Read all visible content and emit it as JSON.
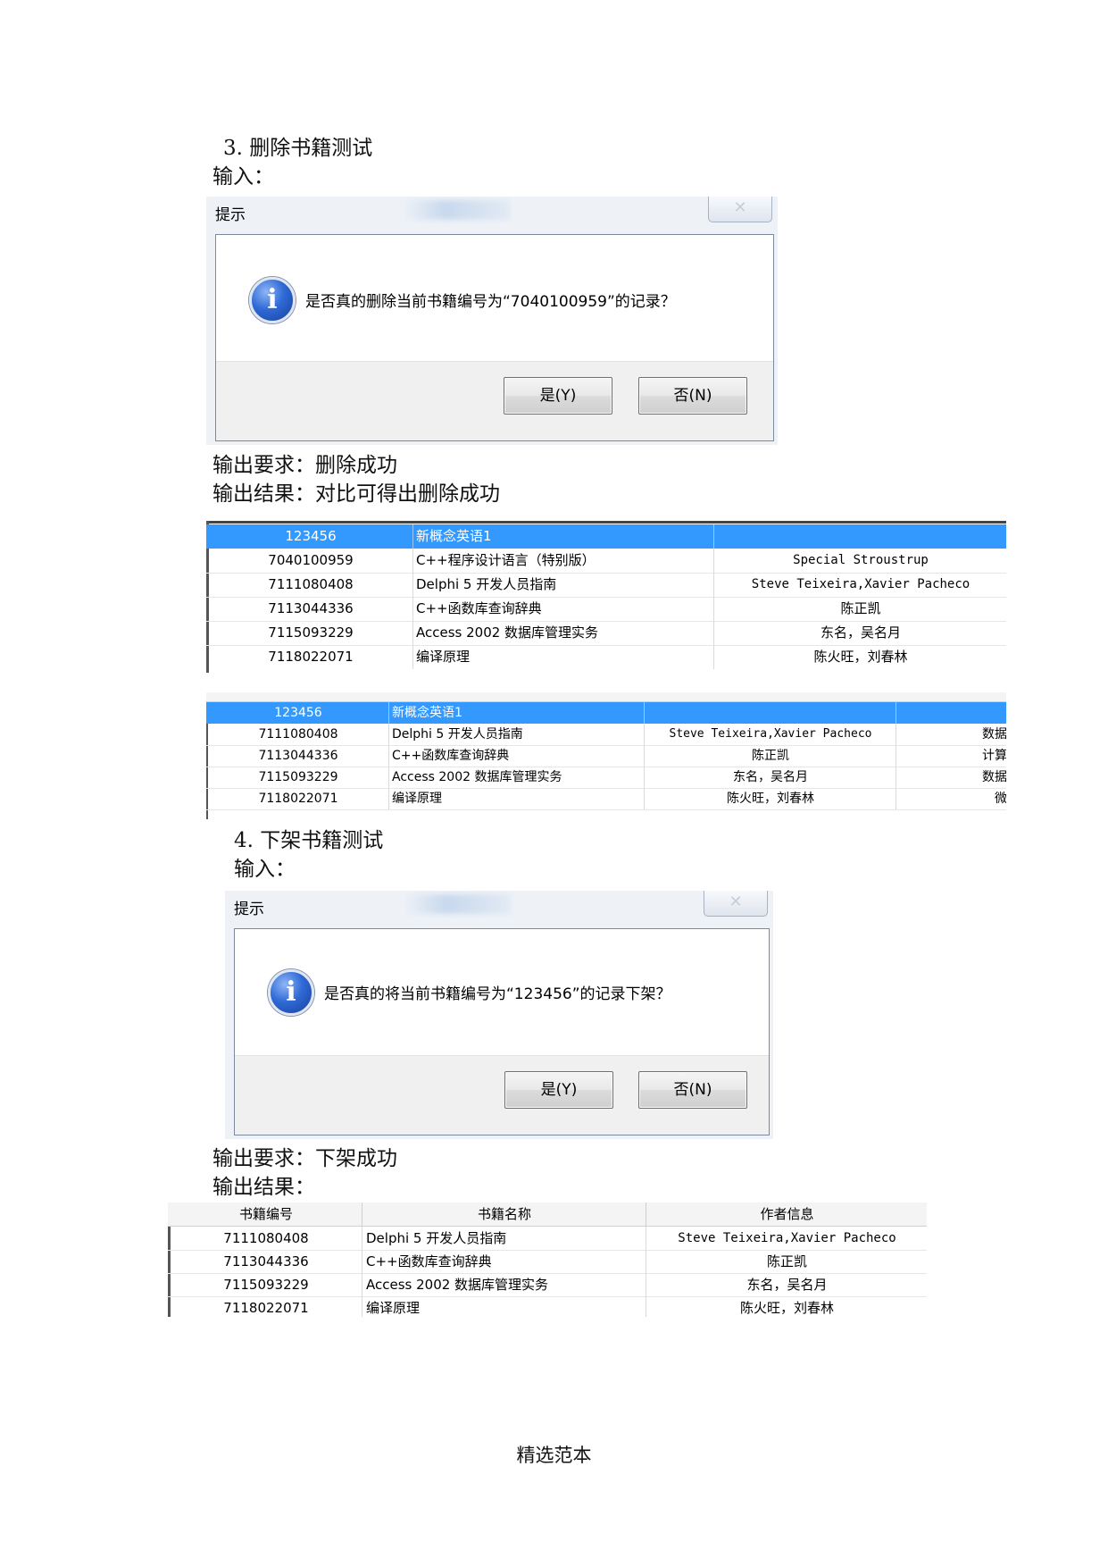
{
  "section3": {
    "heading": "3. 删除书籍测试",
    "input_label": "输入：",
    "dialog": {
      "title": "提示",
      "close": "✕",
      "message": "是否真的删除当前书籍编号为“7040100959”的记录？",
      "yes": "是(Y)",
      "no": "否(N)"
    },
    "expected": "输出要求：删除成功",
    "result": "输出结果：对比可得出删除成功",
    "table_before": {
      "rows": [
        [
          "123456",
          "新概念英语1",
          ""
        ],
        [
          "7040100959",
          "C++程序设计语言（特别版）",
          "Special Stroustrup"
        ],
        [
          "7111080408",
          "Delphi 5 开发人员指南",
          "Steve Teixeira,Xavier Pacheco"
        ],
        [
          "7113044336",
          "C++函数库查询辞典",
          "陈正凯"
        ],
        [
          "7115093229",
          "Access 2002 数据库管理实务",
          "东名，吴名月"
        ],
        [
          "7118022071",
          "编译原理",
          "陈火旺，刘春林"
        ]
      ]
    },
    "table_after": {
      "rows": [
        [
          "123456",
          "新概念英语1",
          "",
          ""
        ],
        [
          "7111080408",
          "Delphi 5 开发人员指南",
          "Steve Teixeira,Xavier Pacheco",
          "数据"
        ],
        [
          "7113044336",
          "C++函数库查询辞典",
          "陈正凯",
          "计算"
        ],
        [
          "7115093229",
          "Access 2002 数据库管理实务",
          "东名，吴名月",
          "数据"
        ],
        [
          "7118022071",
          "编译原理",
          "陈火旺，刘春林",
          "微"
        ]
      ]
    }
  },
  "section4": {
    "heading": "4. 下架书籍测试",
    "input_label": "输入：",
    "dialog": {
      "title": "提示",
      "close": "✕",
      "message": "是否真的将当前书籍编号为“123456”的记录下架？",
      "yes": "是(Y)",
      "no": "否(N)"
    },
    "expected": "输出要求：下架成功",
    "result": "输出结果：",
    "table": {
      "headers": [
        "书籍编号",
        "书籍名称",
        "作者信息"
      ],
      "rows": [
        [
          "7111080408",
          "Delphi 5 开发人员指南",
          "Steve Teixeira,Xavier Pacheco"
        ],
        [
          "7113044336",
          "C++函数库查询辞典",
          "陈正凯"
        ],
        [
          "7115093229",
          "Access 2002 数据库管理实务",
          "东名，吴名月"
        ],
        [
          "7118022071",
          "编译原理",
          "陈火旺，刘春林"
        ]
      ]
    }
  },
  "footer": "精选范本"
}
